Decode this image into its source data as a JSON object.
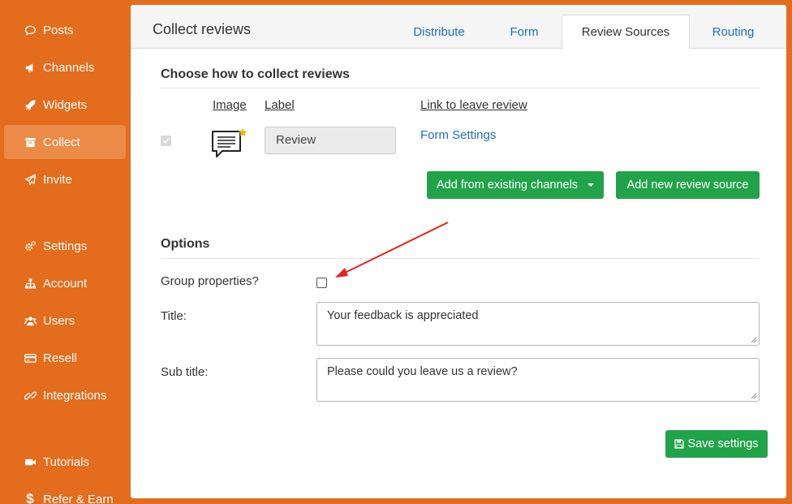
{
  "sidebar": {
    "items": [
      {
        "label": "Posts",
        "icon": "comment-icon"
      },
      {
        "label": "Channels",
        "icon": "megaphone-icon"
      },
      {
        "label": "Widgets",
        "icon": "rocket-icon"
      },
      {
        "label": "Collect",
        "icon": "archive-icon",
        "active": true
      },
      {
        "label": "Invite",
        "icon": "paper-plane-icon"
      },
      {
        "label": "Settings",
        "icon": "gears-icon"
      },
      {
        "label": "Account",
        "icon": "sitemap-icon"
      },
      {
        "label": "Users",
        "icon": "users-icon"
      },
      {
        "label": "Resell",
        "icon": "credit-card-icon"
      },
      {
        "label": "Integrations",
        "icon": "link-icon"
      },
      {
        "label": "Tutorials",
        "icon": "video-camera-icon"
      },
      {
        "label": "Refer & Earn",
        "icon": "dollar-icon"
      }
    ]
  },
  "header": {
    "title": "Collect reviews",
    "tabs": [
      {
        "label": "Distribute"
      },
      {
        "label": "Form"
      },
      {
        "label": "Review Sources",
        "active": true
      },
      {
        "label": "Routing"
      }
    ]
  },
  "sources": {
    "heading": "Choose how to collect reviews",
    "col_image": "Image",
    "col_label": "Label",
    "col_link": "Link to leave review",
    "row": {
      "label_value": "Review",
      "link_text": "Form Settings",
      "checked": true
    },
    "add_existing_label": "Add from existing channels",
    "add_new_label": "Add new review source"
  },
  "options": {
    "heading": "Options",
    "group_label": "Group properties?",
    "group_checked": false,
    "title_label": "Title:",
    "title_value": "Your feedback is appreciated",
    "subtitle_label": "Sub title:",
    "subtitle_value": "Please could you leave us a review?",
    "save_label": "Save settings"
  },
  "colors": {
    "brand_orange": "#e46c1d",
    "active_nav": "#ec8a48",
    "link_blue": "#1f6fb5",
    "button_green": "#21a34a",
    "annotation_red": "#e8221b"
  }
}
